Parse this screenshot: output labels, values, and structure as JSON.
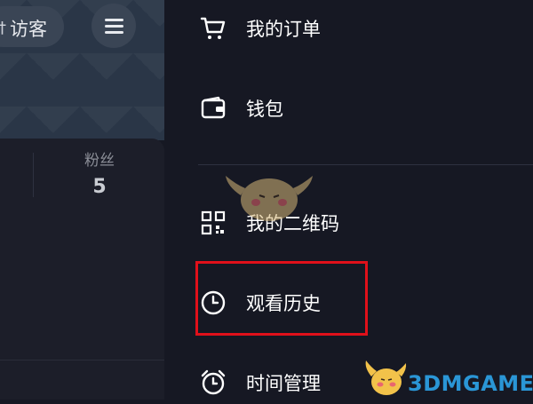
{
  "profile": {
    "visitor_label": "访客",
    "fans_label": "粉丝",
    "fans_count": "5"
  },
  "menu": {
    "items": [
      {
        "label": "我的订单",
        "icon": "cart-icon"
      },
      {
        "label": "钱包",
        "icon": "wallet-icon"
      },
      {
        "label": "我的二维码",
        "icon": "qr-code-icon"
      },
      {
        "label": "观看历史",
        "icon": "clock-icon",
        "highlighted": true
      },
      {
        "label": "时间管理",
        "icon": "alarm-clock-icon"
      }
    ]
  },
  "watermark": {
    "text": "3DMGAME"
  },
  "colors": {
    "background": "#161823",
    "highlight_border": "#e0101a",
    "watermark": "#2a96d6"
  }
}
